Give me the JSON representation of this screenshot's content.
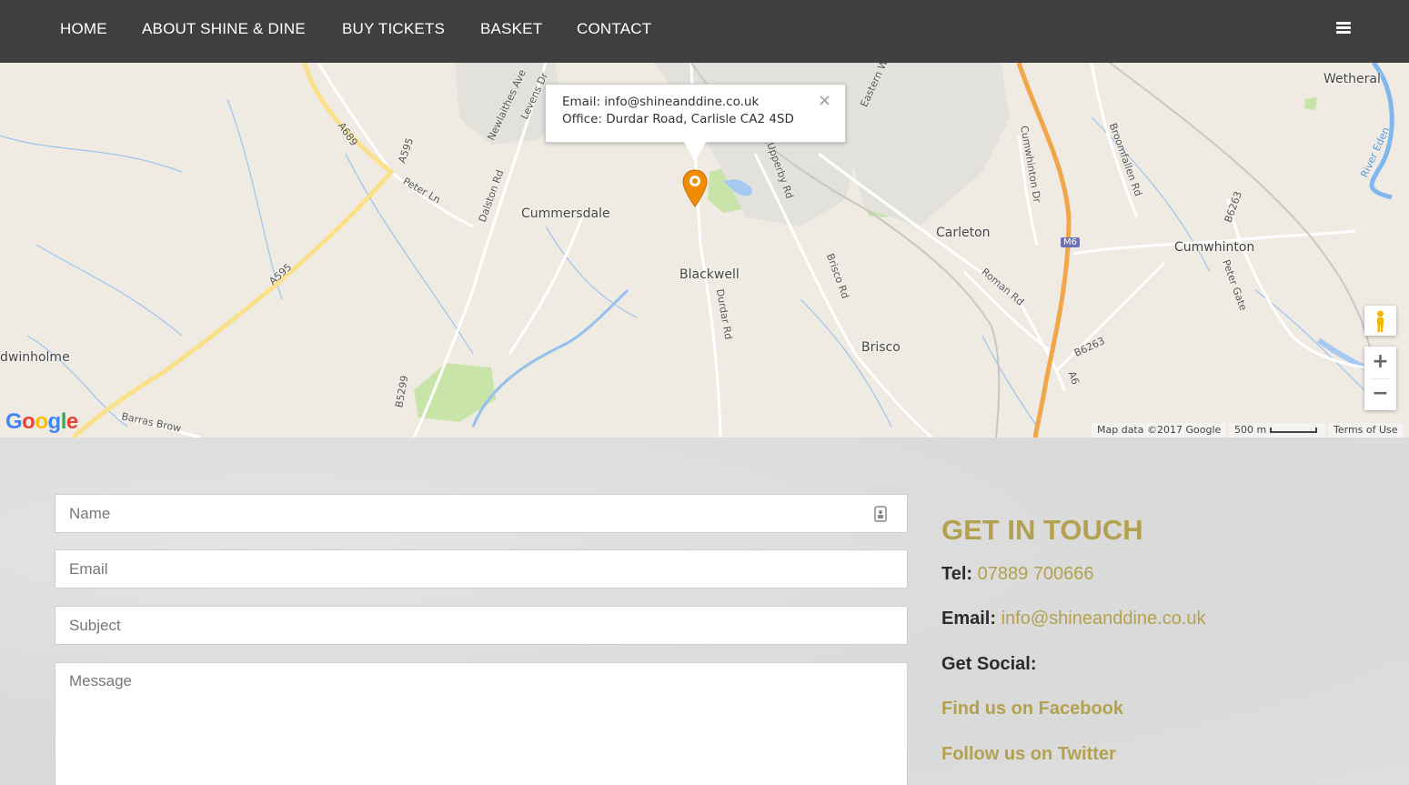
{
  "nav": {
    "items": [
      "HOME",
      "ABOUT SHINE & DINE",
      "BUY TICKETS",
      "BASKET",
      "CONTACT"
    ]
  },
  "map": {
    "places": {
      "wetheral": "Wetheral",
      "cummersdale": "Cummersdale",
      "carleton": "Carleton",
      "cumwhinton": "Cumwhinton",
      "blackwell": "Blackwell",
      "brisco": "Brisco",
      "dwinholme": "dwinholme"
    },
    "roads": {
      "a689": "A689",
      "a595_top": "A595",
      "peter_ln": "Peter Ln",
      "dalston_rd": "Dalston Rd",
      "a595_diag": "A595",
      "b5299": "B5299",
      "durdar_rd": "Durdar Rd",
      "brisco_rd": "Brisco Rd",
      "roman_rd": "Roman Rd",
      "b6263_low": "B6263",
      "a6": "A6",
      "m6": "M6",
      "b6263_right": "B6263",
      "peter_gate": "Peter Gate",
      "broomfallen_rd": "Broomfallen Rd",
      "cumwhinton_dr": "Cumwhinton Dr",
      "river_eden": "River Eden",
      "barras_brow": "Barras Brow",
      "newlaithes_ave": "Newlaithes Ave",
      "levens_dr": "Levens Dr",
      "upperby_rd": "Upperby Rd",
      "eastern_way": "Eastern W"
    },
    "infowindow": {
      "email": "Email: info@shineanddine.co.uk",
      "office": "Office: Durdar Road, Carlisle CA2 4SD",
      "close": "×"
    },
    "zoom_in": "+",
    "zoom_out": "−",
    "footer": {
      "map_data": "Map data ©2017 Google",
      "scale": "500 m",
      "terms": "Terms of Use"
    },
    "logo": [
      "G",
      "o",
      "o",
      "g",
      "l",
      "e"
    ]
  },
  "form": {
    "name_placeholder": "Name",
    "email_placeholder": "Email",
    "subject_placeholder": "Subject",
    "message_placeholder": "Message"
  },
  "touch": {
    "heading": "GET IN TOUCH",
    "tel_label": "Tel:",
    "tel_value": "07889 700666",
    "email_label": "Email:",
    "email_value": "info@shineanddine.co.uk",
    "social_label": "Get Social:",
    "facebook": "Find us on Facebook",
    "twitter": "Follow us on Twitter"
  },
  "colors": {
    "nav_bg": "#3f3f3f",
    "accent_gold": "#b3a150",
    "pin_orange": "#f08c00"
  }
}
